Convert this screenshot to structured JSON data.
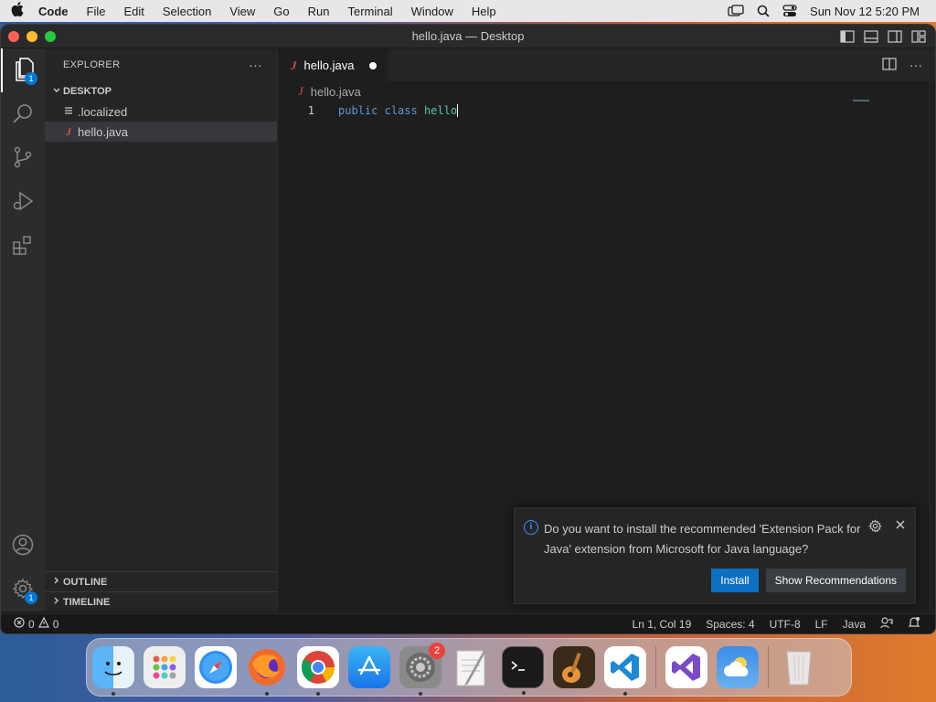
{
  "menubar": {
    "app_name": "Code",
    "items": [
      "File",
      "Edit",
      "Selection",
      "View",
      "Go",
      "Run",
      "Terminal",
      "Window",
      "Help"
    ],
    "clock": "Sun Nov 12  5:20 PM"
  },
  "window": {
    "title": "hello.java — Desktop"
  },
  "activity_bar": {
    "explorer_badge": "1",
    "settings_badge": "1"
  },
  "sidebar": {
    "header": "EXPLORER",
    "more": "···",
    "folder": "DESKTOP",
    "files": [
      ".localized",
      "hello.java"
    ],
    "outline": "OUTLINE",
    "timeline": "TIMELINE"
  },
  "editor": {
    "tab_icon": "J",
    "tab_label": "hello.java",
    "breadcrumb": "hello.java",
    "line_number": "1",
    "code_keyword1": "public",
    "code_keyword2": "class",
    "code_name": "hello"
  },
  "notification": {
    "message": "Do you want to install the recommended 'Extension Pack for Java' extension from Microsoft for Java language?",
    "install": "Install",
    "show_recommendations": "Show Recommendations"
  },
  "statusbar": {
    "errors": "0",
    "warnings": "0",
    "position": "Ln 1, Col 19",
    "spaces": "Spaces: 4",
    "encoding": "UTF-8",
    "eol": "LF",
    "language": "Java"
  },
  "dock": {
    "settings_badge": "2"
  },
  "colors": {
    "accent": "#0e70c0",
    "java_icon": "#e04848",
    "keyword": "#569cd6",
    "class_name": "#4ec9b0"
  }
}
